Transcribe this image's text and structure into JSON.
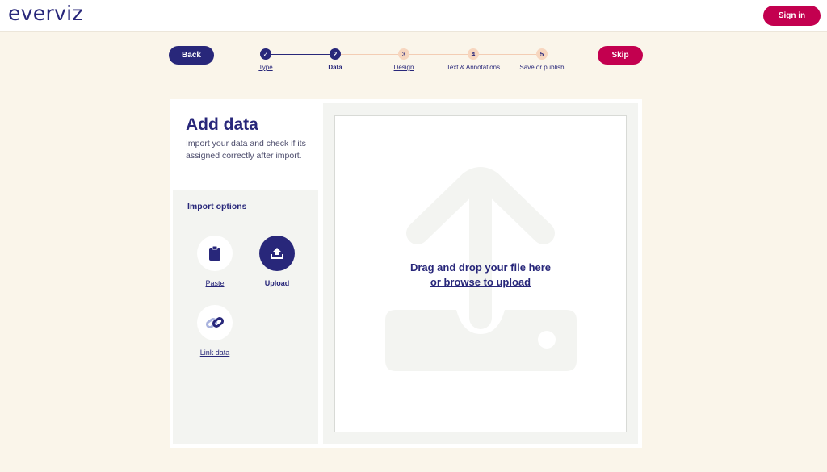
{
  "header": {
    "logo": "everviz",
    "signin_label": "Sign in"
  },
  "nav": {
    "back_label": "Back",
    "skip_label": "Skip"
  },
  "stepper": {
    "steps": [
      {
        "number": "✓",
        "label": "Type"
      },
      {
        "number": "2",
        "label": "Data"
      },
      {
        "number": "3",
        "label": "Design"
      },
      {
        "number": "4",
        "label": "Text & Annotations"
      },
      {
        "number": "5",
        "label": "Save or publish"
      }
    ]
  },
  "panel": {
    "title": "Add data",
    "description": "Import your data and check if its assigned correctly after import.",
    "import_title": "Import options",
    "options": [
      {
        "label": "Paste"
      },
      {
        "label": "Upload"
      },
      {
        "label": "Link data"
      }
    ]
  },
  "dropzone": {
    "line1": "Drag and drop your file here",
    "line2": "or browse to upload"
  },
  "colors": {
    "primary": "#28277a",
    "accent": "#c3004f",
    "background": "#faf5ea",
    "step_future": "#f7d6bf"
  }
}
